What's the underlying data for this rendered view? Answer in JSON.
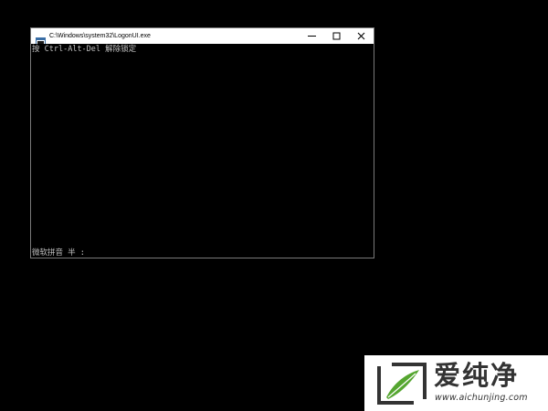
{
  "window": {
    "title": "C:\\Windows\\system32\\LogonUI.exe",
    "icon": "console-app-icon",
    "controls": {
      "minimize_icon": "minimize-icon",
      "maximize_icon": "maximize-icon",
      "close_icon": "close-icon"
    }
  },
  "console": {
    "prompt_text": "按 Ctrl-Alt-Del 解除锁定",
    "ime_status_text": "微软拼音 半 :"
  },
  "watermark": {
    "brand": "爱纯净",
    "url": "www.aichunjing.com",
    "logo_icon": "leaf-logo-icon",
    "colors": {
      "logo_green": "#55a630",
      "logo_dark": "#333333",
      "text_dark": "#333333"
    }
  },
  "colors": {
    "desktop_background": "#000000",
    "console_text": "#c0c0c0",
    "title_bar": "#ffffff"
  }
}
